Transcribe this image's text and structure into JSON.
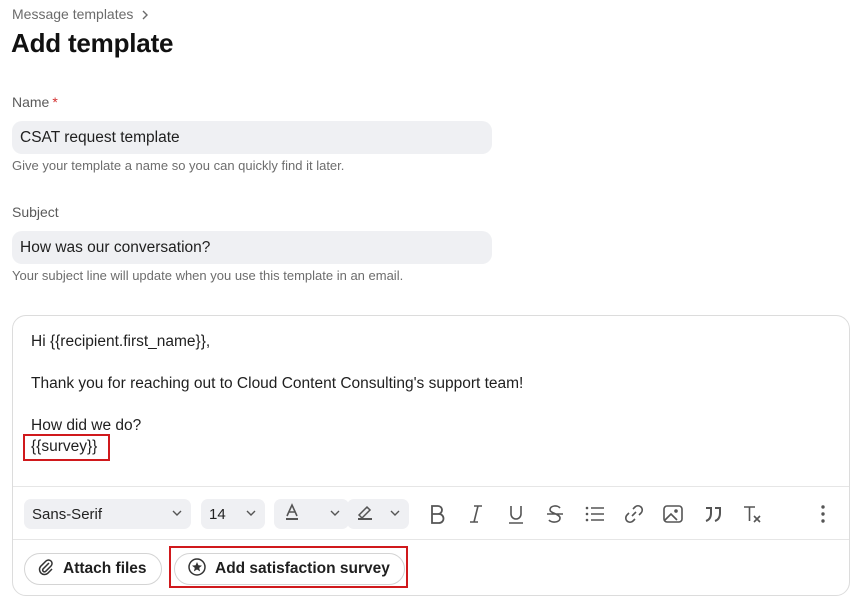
{
  "breadcrumb": {
    "parent": "Message templates"
  },
  "page": {
    "title": "Add template"
  },
  "name_field": {
    "label": "Name",
    "required_marker": "*",
    "value": "CSAT request template",
    "hint": "Give your template a name so you can quickly find it later."
  },
  "subject_field": {
    "label": "Subject",
    "value": "How was our conversation?",
    "hint": "Your subject line will update when you use this template in an email."
  },
  "editor": {
    "line1": "Hi {{recipient.first_name}},",
    "line2": "Thank you for reaching out to Cloud Content Consulting's support team!",
    "line3": "How did we do?",
    "line4": "{{survey}}"
  },
  "toolbar": {
    "font_family": "Sans-Serif",
    "font_size": "14",
    "icons": [
      "text-color-icon",
      "highlight-icon",
      "bold-icon",
      "italic-icon",
      "underline-icon",
      "strikethrough-icon",
      "bullet-list-icon",
      "link-icon",
      "image-icon",
      "quote-icon",
      "clear-format-icon",
      "more-options-icon"
    ]
  },
  "footer": {
    "attach_label": "Attach files",
    "survey_label": "Add satisfaction survey"
  },
  "colors": {
    "highlight_border": "#d0191c",
    "required": "#d32f2f",
    "input_bg": "#eff0f3"
  }
}
